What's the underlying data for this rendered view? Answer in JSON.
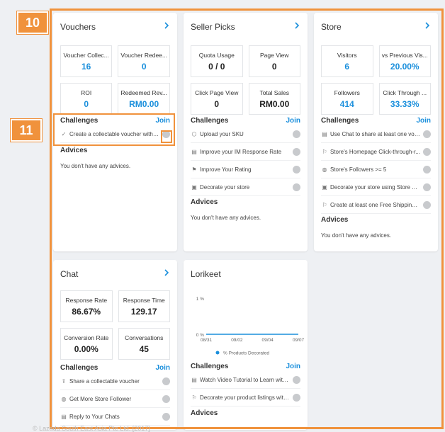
{
  "callouts": [
    "10",
    "11"
  ],
  "vouchers": {
    "title": "Vouchers",
    "metrics": [
      {
        "label": "Voucher Collec...",
        "value": "16"
      },
      {
        "label": "Voucher Redee...",
        "value": "0"
      },
      {
        "label": "ROI",
        "value": "0"
      },
      {
        "label": "Redeemed Rev...",
        "value": "RM0.00"
      }
    ],
    "challenges_label": "Challenges",
    "join_label": "Join",
    "challenges": [
      "Create a collectable voucher with 5..."
    ],
    "advices_label": "Advices",
    "advice_text": "You don't have any advices."
  },
  "seller_picks": {
    "title": "Seller Picks",
    "metrics": [
      {
        "label": "Quota Usage",
        "value": "0 / 0"
      },
      {
        "label": "Page View",
        "value": "0"
      },
      {
        "label": "Click Page View",
        "value": "0"
      },
      {
        "label": "Total Sales",
        "value": "RM0.00"
      }
    ],
    "challenges_label": "Challenges",
    "join_label": "Join",
    "challenges": [
      "Upload your SKU",
      "Improve your IM Response Rate",
      "Improve Your Rating",
      "Decorate your store"
    ],
    "advices_label": "Advices",
    "advice_text": "You don't have any advices."
  },
  "store": {
    "title": "Store",
    "metrics": [
      {
        "label": "Visitors",
        "value": "6"
      },
      {
        "label": "vs Previous Vis...",
        "value": "20.00%"
      },
      {
        "label": "Followers",
        "value": "414"
      },
      {
        "label": "Click Through ...",
        "value": "33.33%"
      }
    ],
    "challenges_label": "Challenges",
    "join_label": "Join",
    "challenges": [
      "Use Chat to share at least one vouc...",
      "Store's Homepage Click-through-r...",
      "Store's Followers >= 5",
      "Decorate your store using Store Bu...",
      "Create at least one Free Shipping P..."
    ],
    "advices_label": "Advices",
    "advice_text": "You don't have any advices."
  },
  "chat": {
    "title": "Chat",
    "metrics": [
      {
        "label": "Response Rate",
        "value": "86.67%"
      },
      {
        "label": "Response Time",
        "value": "129.17"
      },
      {
        "label": "Conversion Rate",
        "value": "0.00%"
      },
      {
        "label": "Conversations",
        "value": "45"
      }
    ],
    "challenges_label": "Challenges",
    "join_label": "Join",
    "challenges": [
      "Share a collectable voucher",
      "Get More Store Follower",
      "Reply to Your Chats"
    ]
  },
  "lorikeet": {
    "title": "Lorikeet",
    "challenges_label": "Challenges",
    "join_label": "Join",
    "challenges": [
      "Watch Video Tutorial to Learn with...",
      "Decorate your product listings with..."
    ],
    "advices_label": "Advices"
  },
  "chart_data": {
    "type": "line",
    "x": [
      "08/31",
      "09/02",
      "09/04",
      "09/07"
    ],
    "series": [
      {
        "name": "% Products Decorated",
        "values": [
          0,
          0,
          0,
          0
        ]
      }
    ],
    "yticks": [
      "1 %",
      "0 %"
    ],
    "ylim": [
      0,
      1
    ],
    "color": "#1a8fdc"
  },
  "footer": "© Lazada South East Asia Pte Ltd. [2017]"
}
